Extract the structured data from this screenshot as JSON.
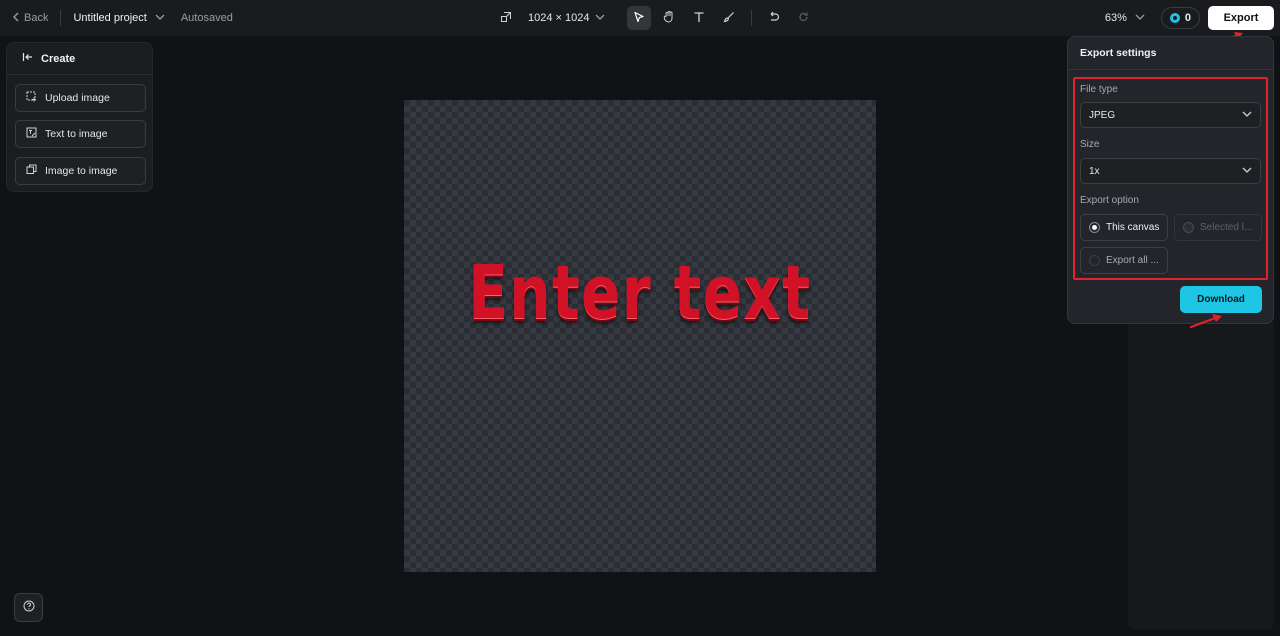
{
  "topbar": {
    "back_label": "Back",
    "project_name": "Untitled project",
    "autosaved": "Autosaved",
    "canvas_size": "1024 × 1024",
    "zoom": "63%",
    "credits": "0",
    "export_label": "Export"
  },
  "create_panel": {
    "title": "Create",
    "items": [
      {
        "label": "Upload image",
        "icon": "upload-image-icon"
      },
      {
        "label": "Text to image",
        "icon": "text-to-image-icon"
      },
      {
        "label": "Image to image",
        "icon": "image-to-image-icon"
      }
    ]
  },
  "canvas": {
    "text": "Enter text"
  },
  "export_settings": {
    "title": "Export settings",
    "file_type_label": "File type",
    "file_type_value": "JPEG",
    "size_label": "Size",
    "size_value": "1x",
    "export_option_label": "Export option",
    "option_this_canvas": "This canvas",
    "option_selected": "Selected l...",
    "option_export_all": "Export all ...",
    "download_label": "Download"
  },
  "colors": {
    "accent": "#1fc6e3",
    "highlight": "#e0232c",
    "text_fill": "#d11226"
  }
}
